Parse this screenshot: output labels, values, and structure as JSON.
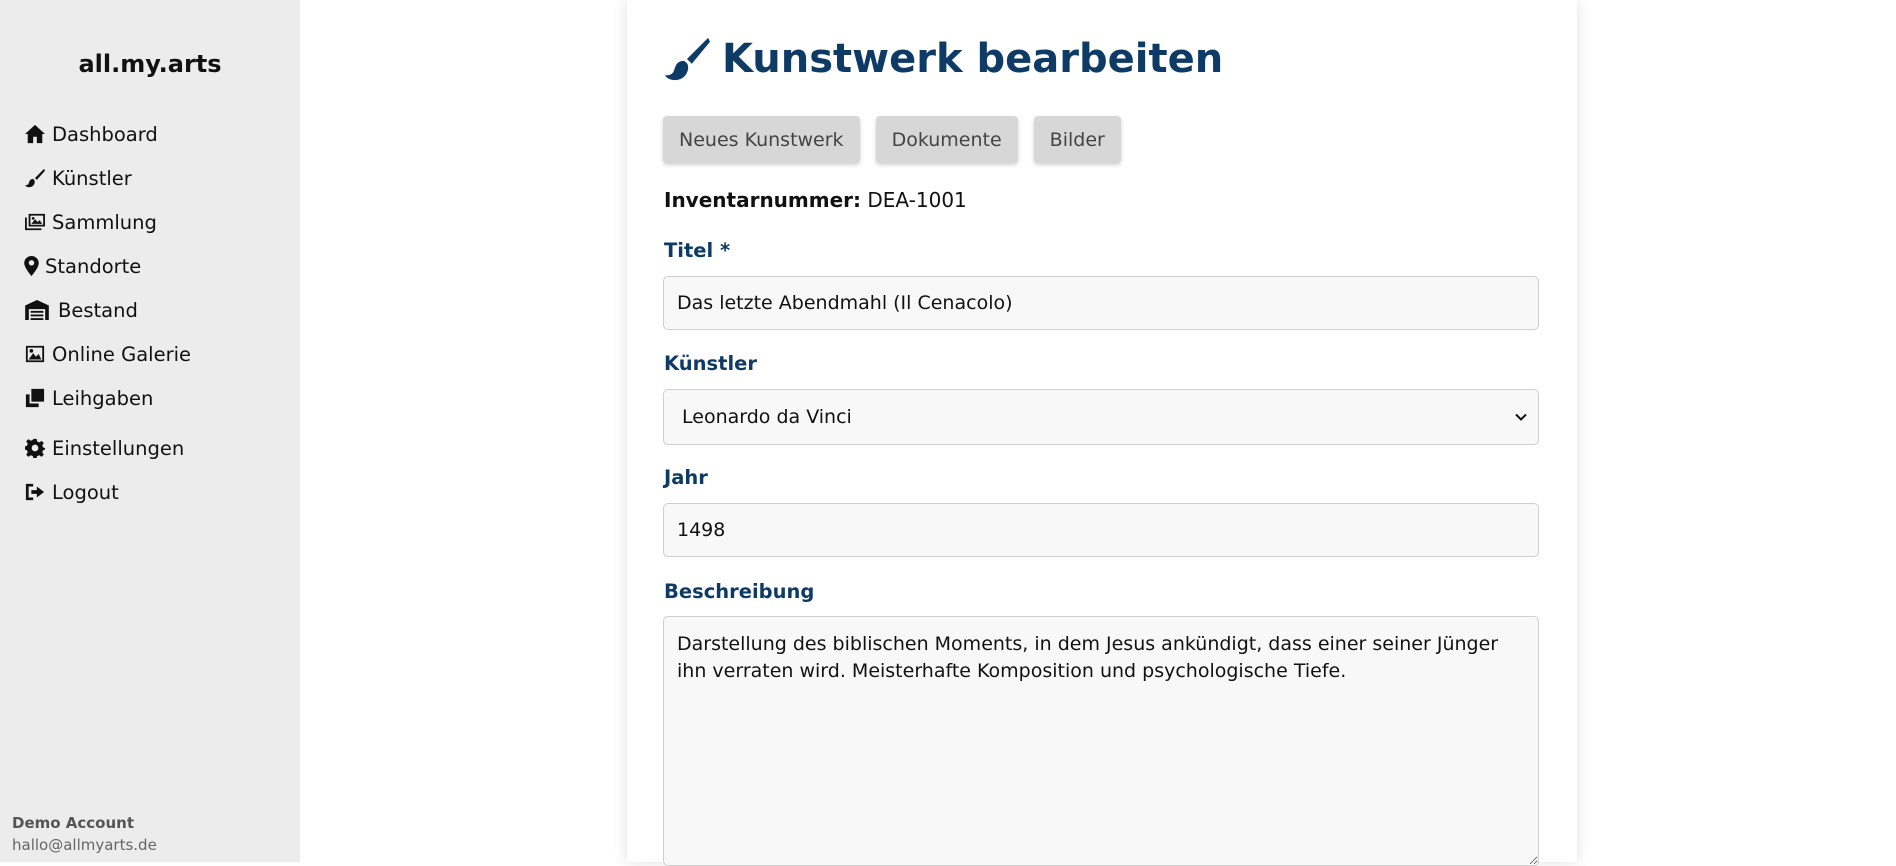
{
  "app": {
    "brand": "all.my.arts"
  },
  "sidebar": {
    "items": [
      {
        "label": "Dashboard",
        "icon": "home-icon"
      },
      {
        "label": "Künstler",
        "icon": "paintbrush-icon"
      },
      {
        "label": "Sammlung",
        "icon": "images-icon"
      },
      {
        "label": "Standorte",
        "icon": "map-pin-icon"
      },
      {
        "label": "Bestand",
        "icon": "warehouse-icon"
      },
      {
        "label": "Online Galerie",
        "icon": "image-icon"
      },
      {
        "label": "Leihgaben",
        "icon": "clone-icon"
      },
      {
        "label": "Einstellungen",
        "icon": "gear-icon"
      },
      {
        "label": "Logout",
        "icon": "logout-icon"
      }
    ],
    "account": {
      "name": "Demo Account",
      "email": "hallo@allmyarts.de"
    }
  },
  "page": {
    "title": "Kunstwerk bearbeiten",
    "title_icon": "paintbrush-icon",
    "buttons": {
      "new_artwork": "Neues Kunstwerk",
      "documents": "Dokumente",
      "images": "Bilder"
    },
    "inventory": {
      "label": "Inventarnummer:",
      "value": "DEA-1001"
    }
  },
  "form": {
    "title": {
      "label": "Titel *",
      "value": "Das letzte Abendmahl (Il Cenacolo)"
    },
    "artist": {
      "label": "Künstler",
      "value": "Leonardo da Vinci"
    },
    "year": {
      "label": "Jahr",
      "value": "1498"
    },
    "description": {
      "label": "Beschreibung",
      "value": "Darstellung des biblischen Moments, in dem Jesus ankündigt, dass einer seiner Jünger ihn verraten wird. Meisterhafte Komposition und psychologische Tiefe."
    }
  },
  "colors": {
    "accent": "#0e3a66",
    "sidebar_bg": "#ececec",
    "button_bg": "#d7d7d7"
  }
}
